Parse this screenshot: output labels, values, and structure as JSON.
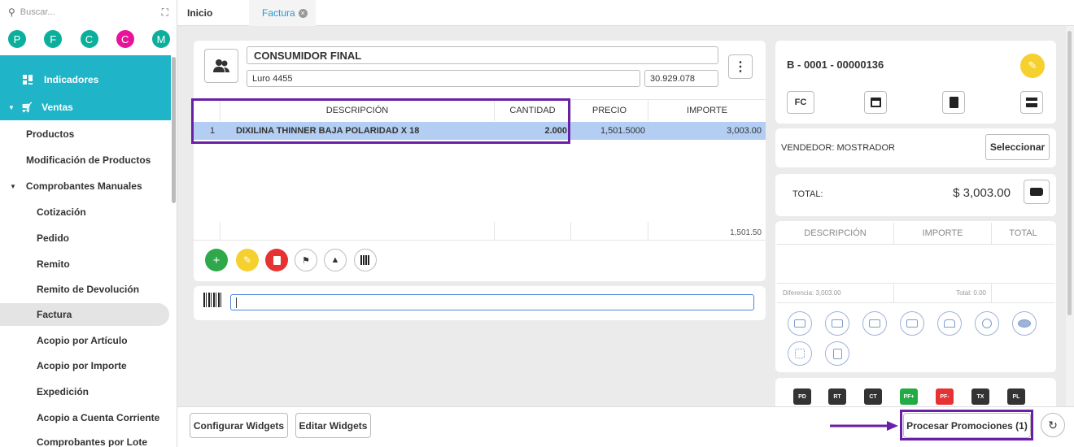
{
  "sidebar": {
    "search_placeholder": "Buscar...",
    "avatars": [
      "P",
      "F",
      "C",
      "C",
      "M"
    ],
    "items": [
      "Indicadores",
      "Ventas",
      "Productos",
      "Modificación de Productos",
      "Comprobantes Manuales",
      "Cotización",
      "Pedido",
      "Remito",
      "Remito de Devolución",
      "Factura",
      "Acopio por Artículo",
      "Acopio por Importe",
      "Expedición",
      "Acopio a Cuenta Corriente",
      "Comprobantes por Lote"
    ]
  },
  "tabs": {
    "inicio": "Inicio",
    "factura": "Factura",
    "factura_close": "×"
  },
  "client": {
    "name": "CONSUMIDOR FINAL",
    "address": "Luro 4455",
    "cuit": "30.929.078"
  },
  "table": {
    "headers": [
      "DESCRIPCIÓN",
      "CANTIDAD",
      "PRECIO",
      "IMPORTE"
    ],
    "row": {
      "num": "1",
      "desc": "DIXILINA THINNER BAJA POLARIDAD X 18",
      "qty": "2.000",
      "price": "1,501.5000",
      "amount": "3,003.00"
    },
    "footer_total": "1,501.50"
  },
  "invoice": {
    "number": "B - 0001 - 00000136",
    "type": "FC"
  },
  "seller": {
    "label": "VENDEDOR: MOSTRADOR",
    "button": "Seleccionar"
  },
  "total": {
    "label": "TOTAL:",
    "value": "$ 3,003.00"
  },
  "payments": {
    "headers": [
      "DESCRIPCIÓN",
      "IMPORTE",
      "TOTAL"
    ],
    "diferencia": "Diferencia: 3,003.00",
    "total": "Total: 0.00"
  },
  "docs": [
    "PD",
    "RT",
    "CT",
    "PF+",
    "PF-",
    "TX",
    "PL"
  ],
  "bottom": {
    "config": "Configurar Widgets",
    "edit": "Editar Widgets",
    "promo": "Procesar Promociones (1)"
  },
  "colors": {
    "accent": "#1fb4c8",
    "highlight_box": "#6a1fa8",
    "selected_row": "#b3cdf3"
  }
}
